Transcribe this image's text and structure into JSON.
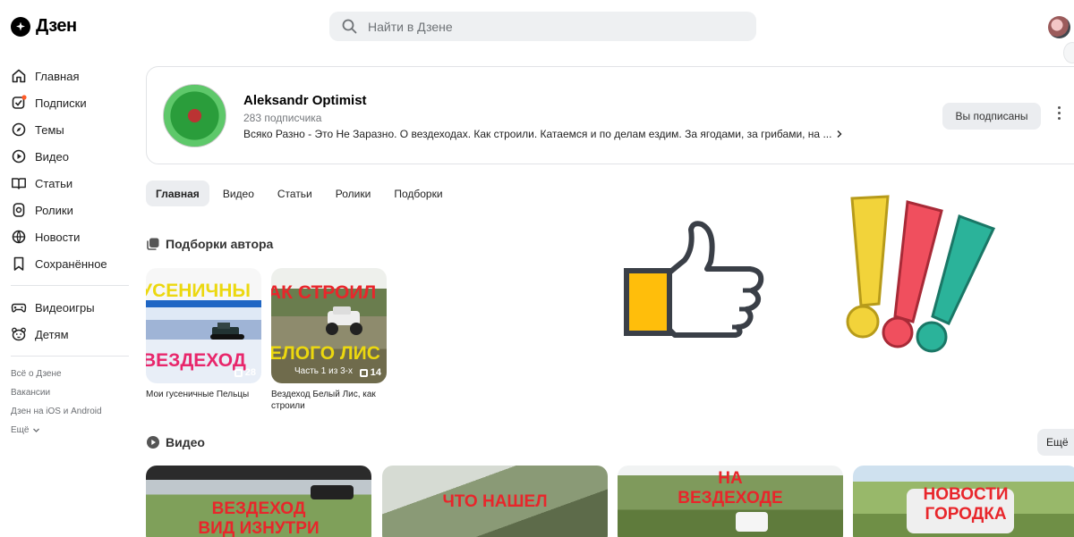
{
  "header": {
    "logo_text": "Дзен",
    "search_placeholder": "Найти в Дзене"
  },
  "sidebar": {
    "items": [
      {
        "label": "Главная",
        "icon": "home-icon"
      },
      {
        "label": "Подписки",
        "icon": "subscriptions-icon"
      },
      {
        "label": "Темы",
        "icon": "compass-icon"
      },
      {
        "label": "Видео",
        "icon": "play-icon"
      },
      {
        "label": "Статьи",
        "icon": "book-icon"
      },
      {
        "label": "Ролики",
        "icon": "clip-icon"
      },
      {
        "label": "Новости",
        "icon": "news-icon"
      },
      {
        "label": "Сохранённое",
        "icon": "bookmark-icon"
      }
    ],
    "items2": [
      {
        "label": "Видеоигры",
        "icon": "gamepad-icon"
      },
      {
        "label": "Детям",
        "icon": "bear-icon"
      }
    ],
    "footer_links": [
      "Всё о Дзене",
      "Вакансии",
      "Дзен на iOS и Android",
      "Ещё"
    ]
  },
  "channel": {
    "name": "Aleksandr Optimist",
    "subscribers": "283 подписчика",
    "description": "Всяко Разно - Это Не Заразно. О вездеходах. Как строили. Катаемся и по делам ездим. За ягодами, за грибами, на ...",
    "subscribed_label": "Вы подписаны"
  },
  "tabs": [
    "Главная",
    "Видео",
    "Статьи",
    "Ролики",
    "Подборки"
  ],
  "collections": {
    "title": "Подборки автора",
    "items": [
      {
        "title": "Мои гусеничные Пельцы",
        "count": "28",
        "overlay_top": "УСЕНИЧНЫ",
        "overlay_bottom": "ВЕЗДЕХОД"
      },
      {
        "title": "Вездеход Белый Лис, как строили",
        "count": "14",
        "overlay_top": "АК СТРОИЛ",
        "overlay_bottom": "ЕЛОГО ЛИС",
        "overlay_small": "Часть 1 из 3-х"
      }
    ]
  },
  "videos": {
    "title": "Видео",
    "more_label": "Ещё",
    "items": [
      {
        "overlay": "ВЕЗДЕХОД\nВИД ИЗНУТРИ"
      },
      {
        "overlay": "ЧТО НАШЕЛ"
      },
      {
        "overlay": "НА\nВЕЗДЕХОДЕ"
      },
      {
        "overlay": "НОВОСТИ\nГОРОДКА"
      }
    ]
  },
  "colors": {
    "accent_red": "#e8262b",
    "yellow": "#f2d33a",
    "pink": "#f04f5e",
    "teal": "#2bb39a",
    "thumb_yellow": "#ffbe0b"
  }
}
